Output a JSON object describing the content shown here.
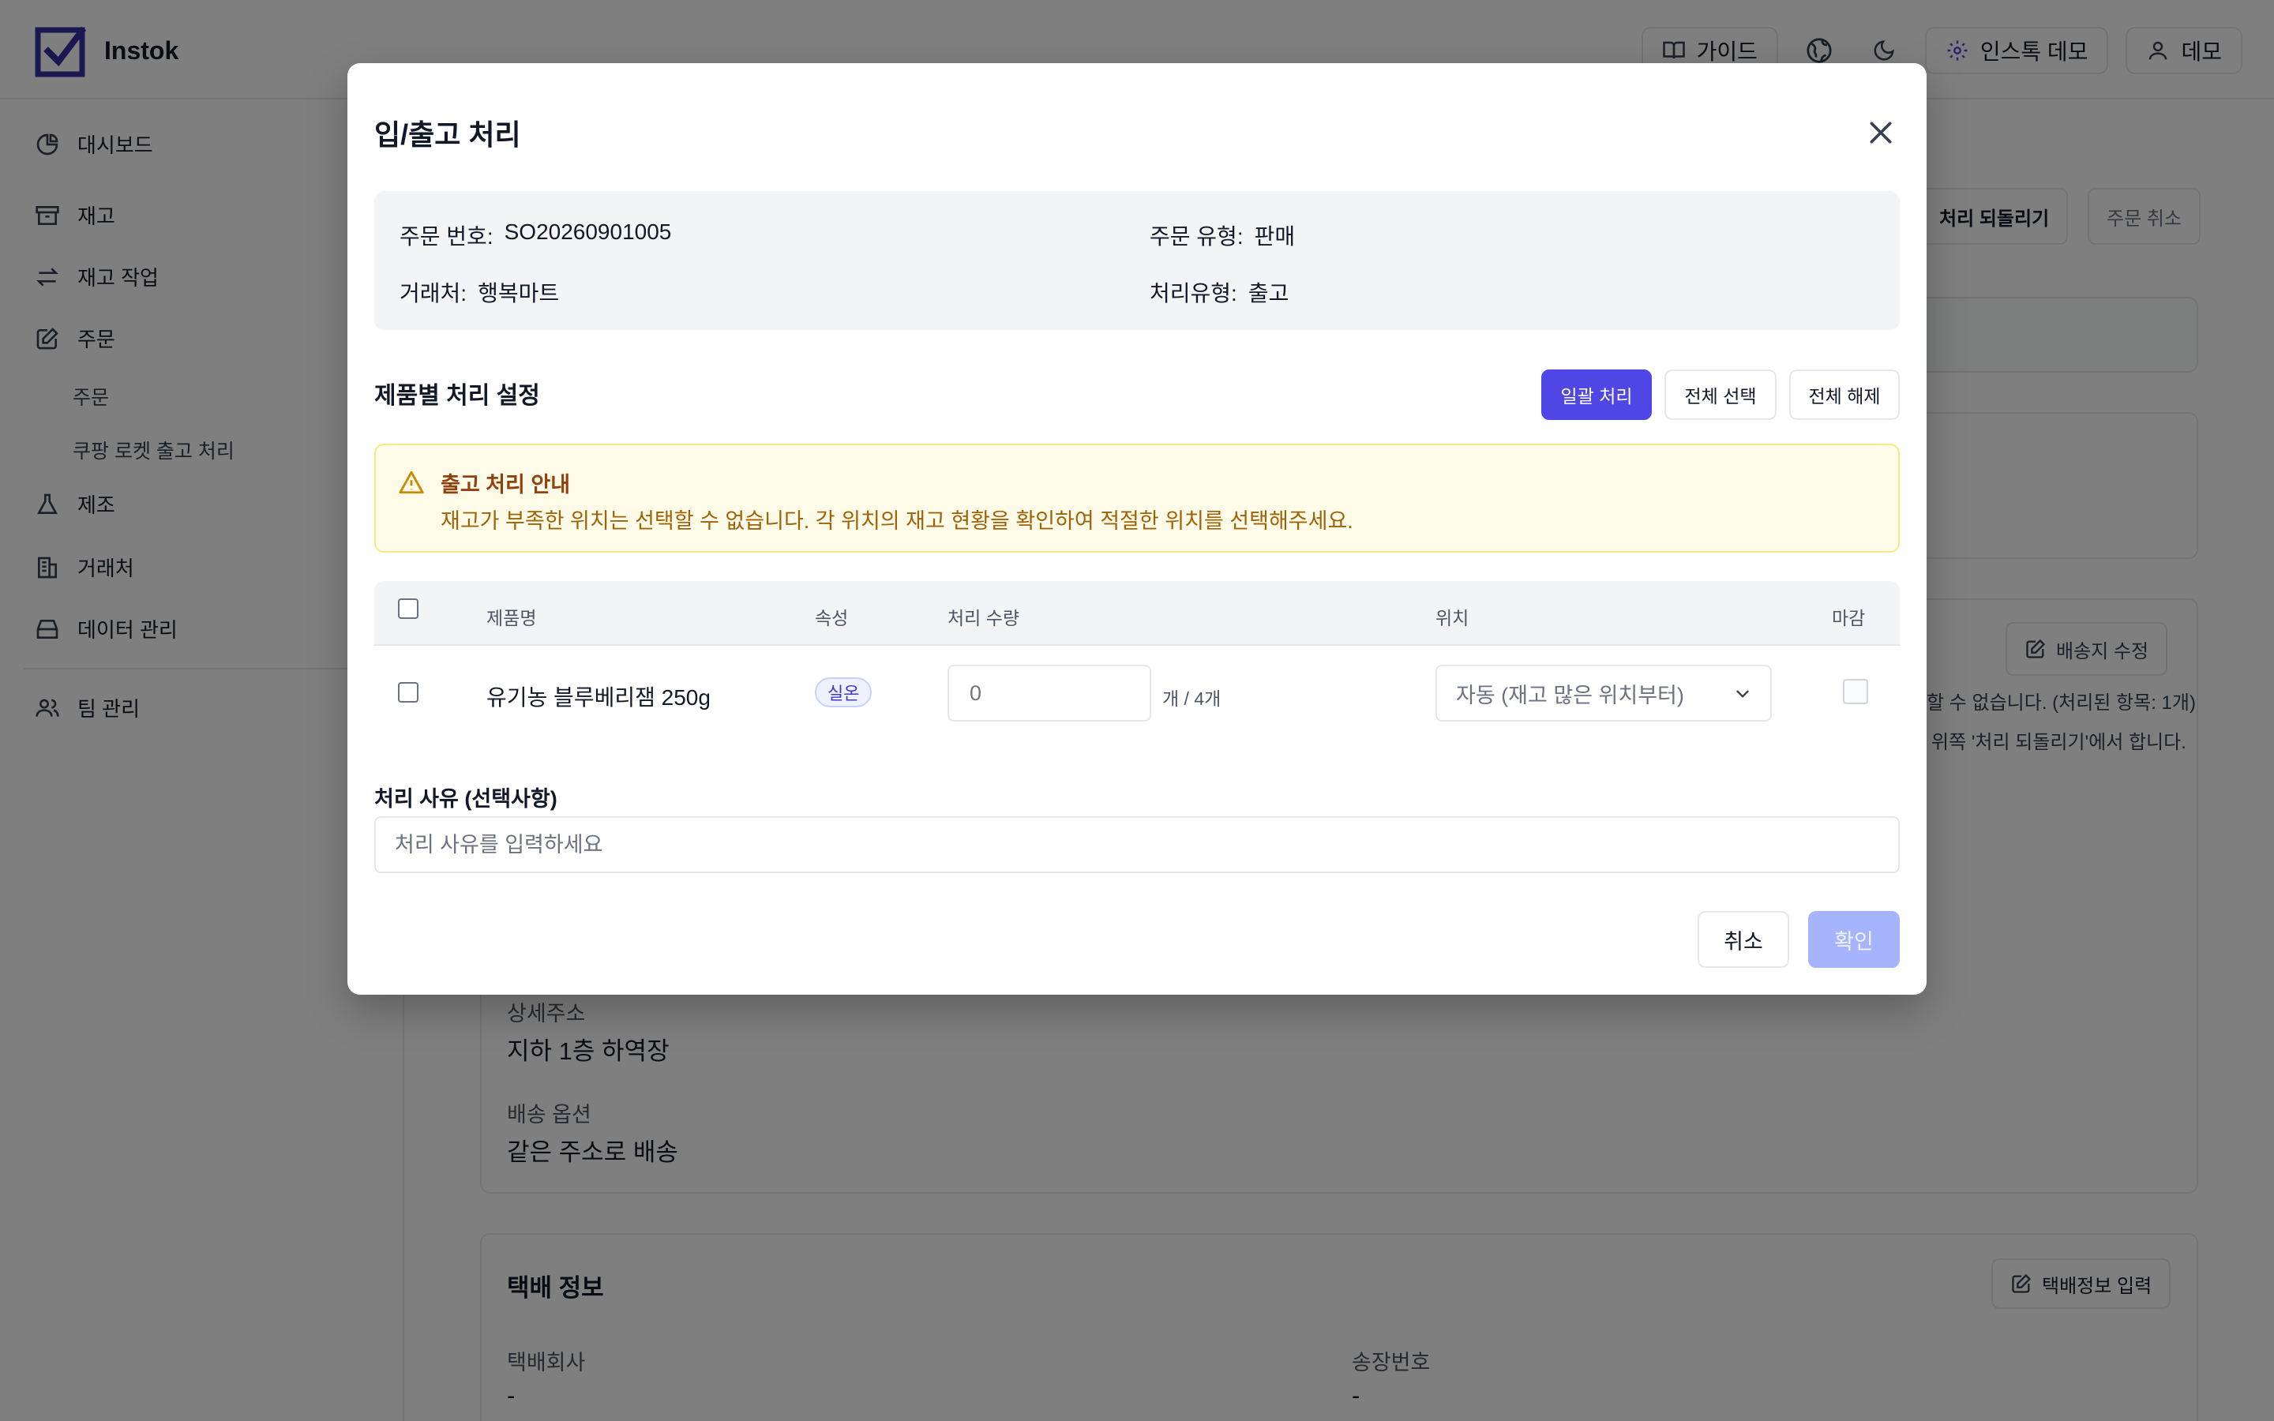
{
  "app": {
    "name": "Instok",
    "header": {
      "guide_label": "가이드",
      "org_label": "인스톡 데모",
      "user_label": "데모"
    },
    "sidebar": {
      "items": [
        {
          "label": "대시보드"
        },
        {
          "label": "재고"
        },
        {
          "label": "재고 작업"
        },
        {
          "label": "주문"
        },
        {
          "label": "주문"
        },
        {
          "label": "쿠팡 로켓 출고 처리"
        },
        {
          "label": "제조"
        },
        {
          "label": "거래처"
        },
        {
          "label": "데이터 관리"
        },
        {
          "label": "팀 관리"
        }
      ]
    },
    "background": {
      "revert_label": "처리 되돌리기",
      "cancel_order_label": "주문 취소",
      "edit_shipping_label": "배송지 수정",
      "note_line1": "할 수 없습니다. (처리된 항목: 1개)",
      "note_line2": "위쪽 '처리 되돌리기'에서 합니다.",
      "detail_address_label": "상세주소",
      "detail_address_value": "지하 1층 하역장",
      "shipping_option_label": "배송 옵션",
      "shipping_option_value": "같은 주소로 배송",
      "courier_title": "택배 정보",
      "courier_input_label": "택배정보 입력",
      "courier_company_label": "택배회사",
      "courier_company_value": "-",
      "tracking_label": "송장번호",
      "tracking_value": "-"
    }
  },
  "modal": {
    "title": "입/출고 처리",
    "info": {
      "order_number_label": "주문 번호:",
      "order_number_value": "SO20260901005",
      "order_type_label": "주문 유형:",
      "order_type_value": "판매",
      "partner_label": "거래처:",
      "partner_value": "행복마트",
      "process_type_label": "처리유형:",
      "process_type_value": "출고"
    },
    "section_title": "제품별 처리 설정",
    "buttons": {
      "bulk": "일괄 처리",
      "select_all": "전체 선택",
      "deselect_all": "전체 해제"
    },
    "alert": {
      "title": "출고 처리 안내",
      "text": "재고가 부족한 위치는 선택할 수 없습니다. 각 위치의 재고 현황을 확인하여 적절한 위치를 선택해주세요."
    },
    "table": {
      "columns": [
        "제품명",
        "속성",
        "처리 수량",
        "위치",
        "마감"
      ],
      "rows": [
        {
          "product": "유기농 블루베리잼 250g",
          "attribute": "실온",
          "quantity_placeholder": "0",
          "quantity_suffix": "개 / 4개",
          "location": "자동 (재고 많은 위치부터)"
        }
      ]
    },
    "reason": {
      "label": "처리 사유 (선택사항)",
      "placeholder": "처리 사유를 입력하세요"
    },
    "footer": {
      "cancel": "취소",
      "confirm": "확인"
    }
  },
  "colors": {
    "primary": "#4f46e5",
    "confirm_disabled": "#a5b4fc",
    "alert_bg": "#fefce8",
    "alert_text": "#a16207"
  }
}
